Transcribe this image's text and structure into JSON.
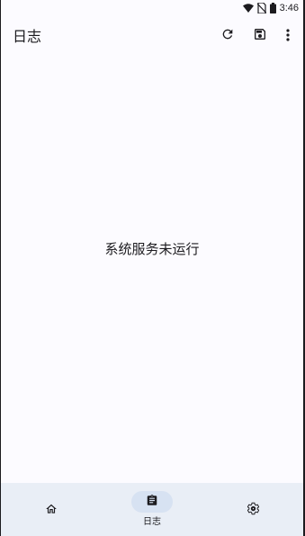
{
  "status_bar": {
    "time": "3:46",
    "icons": [
      "wifi-icon",
      "no-sim-icon",
      "battery-icon"
    ]
  },
  "app_bar": {
    "title": "日志",
    "actions": [
      "refresh-icon",
      "save-icon",
      "more-vert-icon"
    ]
  },
  "main": {
    "empty_message": "系统服务未运行"
  },
  "bottom_nav": {
    "items": [
      {
        "icon": "home-icon",
        "label": "",
        "selected": false
      },
      {
        "icon": "clipboard-icon",
        "label": "日志",
        "selected": true
      },
      {
        "icon": "gear-icon",
        "label": "",
        "selected": false
      }
    ]
  },
  "colors": {
    "background": "#fcfbff",
    "nav_background": "#e9eef6",
    "nav_active_indicator": "#d7e2f2",
    "text": "#1c1b1f"
  }
}
